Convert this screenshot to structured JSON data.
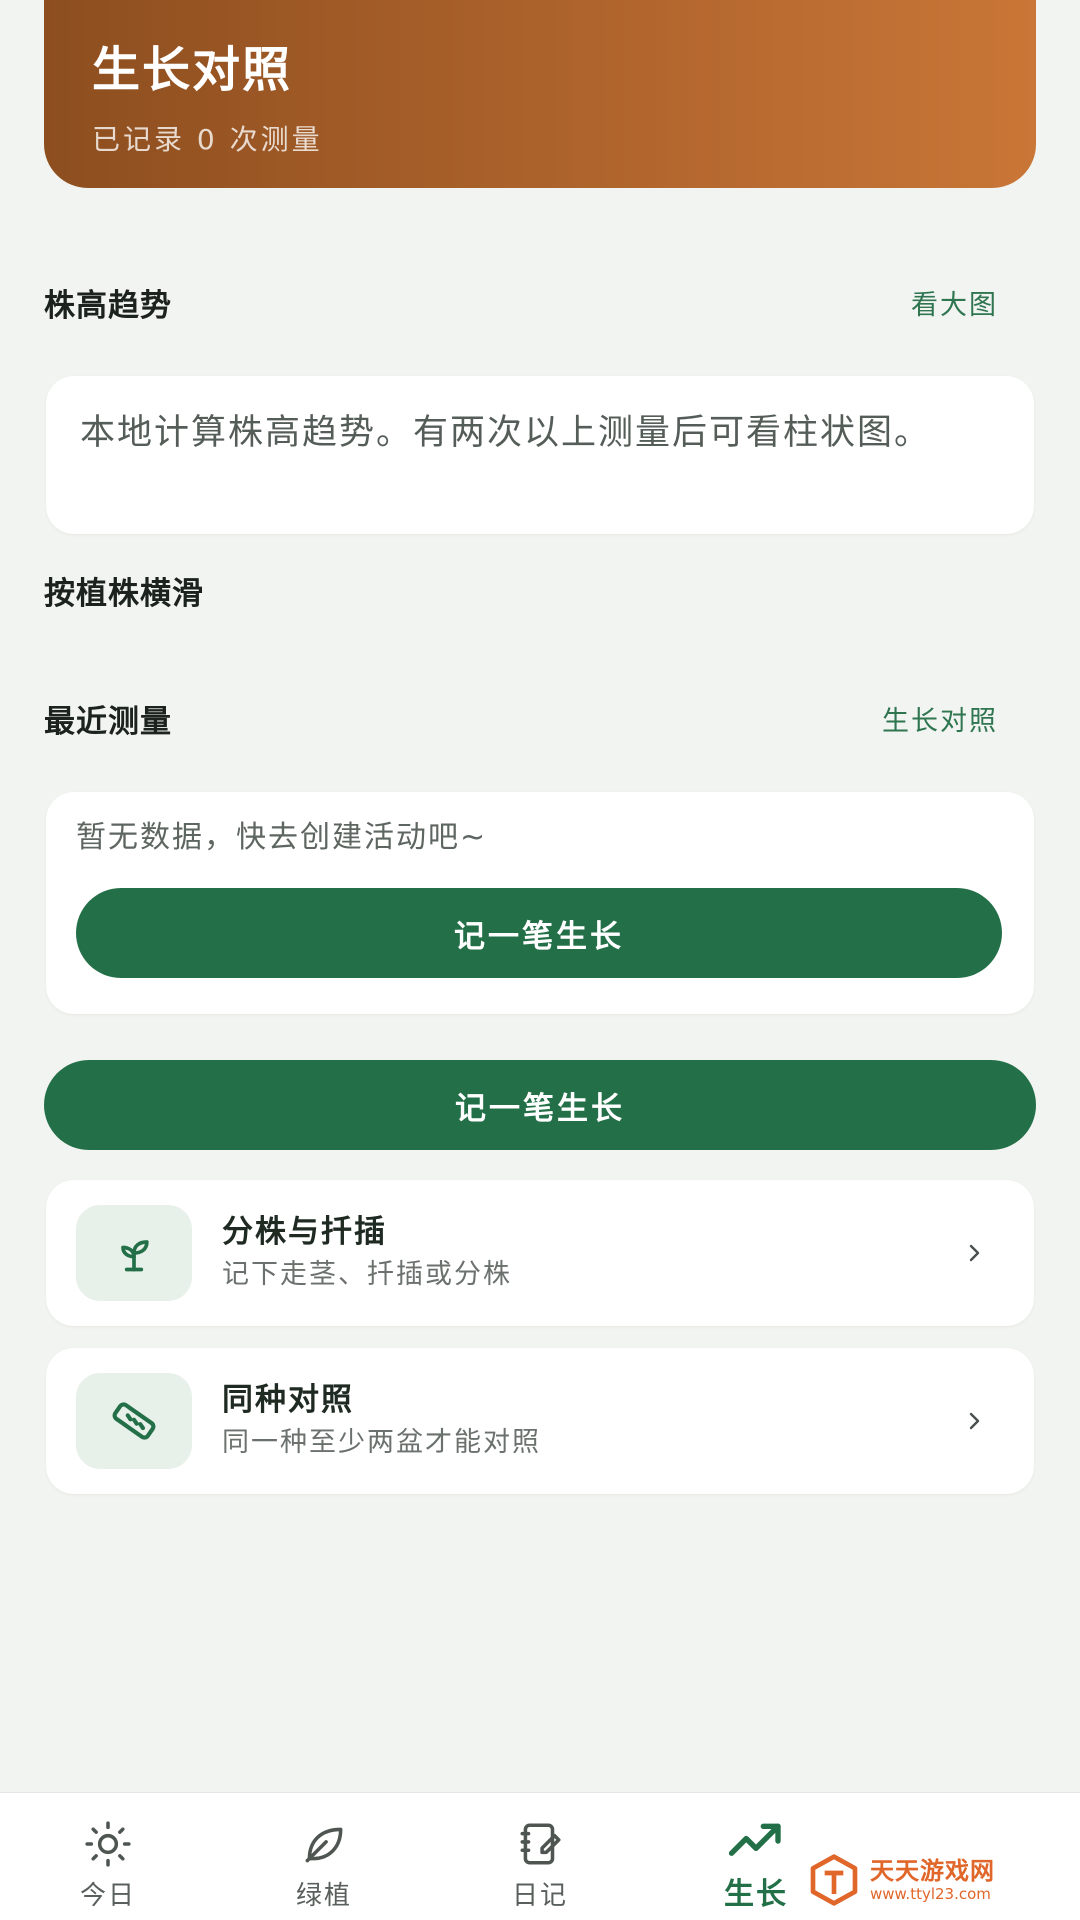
{
  "header": {
    "title": "生长对照",
    "subtitle": "已记录 0 次测量"
  },
  "trend": {
    "title": "株高趋势",
    "link": "看大图",
    "description": "本地计算株高趋势。有两次以上测量后可看柱状图。"
  },
  "swipe": {
    "label": "按植株横滑"
  },
  "recent": {
    "title": "最近测量",
    "link": "生长对照",
    "empty_text": "暂无数据，快去创建活动吧~",
    "button_label": "记一笔生长"
  },
  "primary_button": {
    "label": "记一笔生长"
  },
  "list": [
    {
      "title": "分株与扦插",
      "subtitle": "记下走茎、扦插或分株",
      "icon": "sprout-icon"
    },
    {
      "title": "同种对照",
      "subtitle": "同一种至少两盆才能对照",
      "icon": "ruler-icon"
    }
  ],
  "tabbar": {
    "tabs": [
      {
        "label": "今日",
        "icon": "sun-icon"
      },
      {
        "label": "绿植",
        "icon": "leaf-icon"
      },
      {
        "label": "日记",
        "icon": "notebook-icon"
      },
      {
        "label": "生长",
        "icon": "trend-icon",
        "active": true
      }
    ]
  },
  "watermark": {
    "name": "天天游戏网",
    "url": "www.ttyl23.com"
  },
  "colors": {
    "accent_green": "#237048",
    "link_green": "#2E7550",
    "hero_start": "#8D4E1F",
    "hero_end": "#C97637",
    "background": "#F2F4F1"
  }
}
